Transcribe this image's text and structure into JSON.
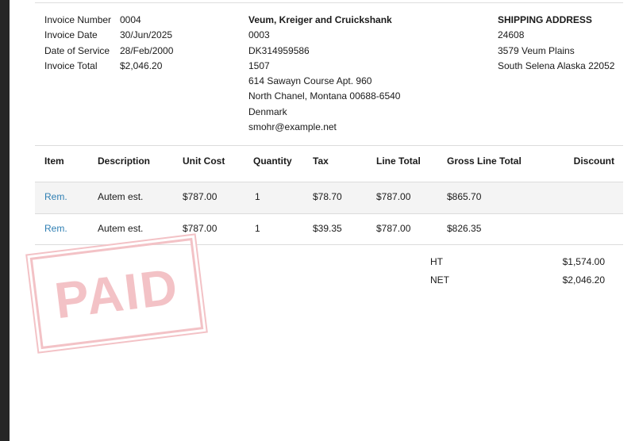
{
  "invoice_meta": [
    {
      "label": "Invoice Number",
      "value": "0004"
    },
    {
      "label": "Invoice Date",
      "value": "30/Jun/2025"
    },
    {
      "label": "Date of Service",
      "value": "28/Feb/2000"
    },
    {
      "label": "Invoice Total",
      "value": "$2,046.20"
    }
  ],
  "vendor": {
    "name": "Veum, Kreiger and Cruickshank",
    "lines": [
      "0003",
      "DK314959586",
      "1507",
      "614 Sawayn Course Apt. 960",
      "North Chanel, Montana 00688-6540",
      "Denmark",
      "smohr@example.net"
    ]
  },
  "shipping": {
    "title": "SHIPPING ADDRESS",
    "lines": [
      "24608",
      "3579 Veum Plains",
      "South Selena Alaska 22052"
    ]
  },
  "table": {
    "headers": {
      "item": "Item",
      "description": "Description",
      "unit_cost": "Unit Cost",
      "quantity": "Quantity",
      "tax": "Tax",
      "line_total": "Line Total",
      "gross_line_total": "Gross Line Total",
      "discount": "Discount"
    },
    "rows": [
      {
        "item": "Rem.",
        "description": "Autem est.",
        "unit_cost": "$787.00",
        "quantity": "1",
        "tax": "$78.70",
        "line_total": "$787.00",
        "gross_line_total": "$865.70",
        "discount": ""
      },
      {
        "item": "Rem.",
        "description": "Autem est.",
        "unit_cost": "$787.00",
        "quantity": "1",
        "tax": "$39.35",
        "line_total": "$787.00",
        "gross_line_total": "$826.35",
        "discount": ""
      }
    ]
  },
  "totals": [
    {
      "label": "HT",
      "value": "$1,574.00"
    },
    {
      "label": "NET",
      "value": "$2,046.20"
    }
  ],
  "stamp": {
    "text": "PAID"
  },
  "colors": {
    "link": "#2f7fb3",
    "stamp": "#f3c2c6",
    "row_shade": "#f4f4f4"
  }
}
